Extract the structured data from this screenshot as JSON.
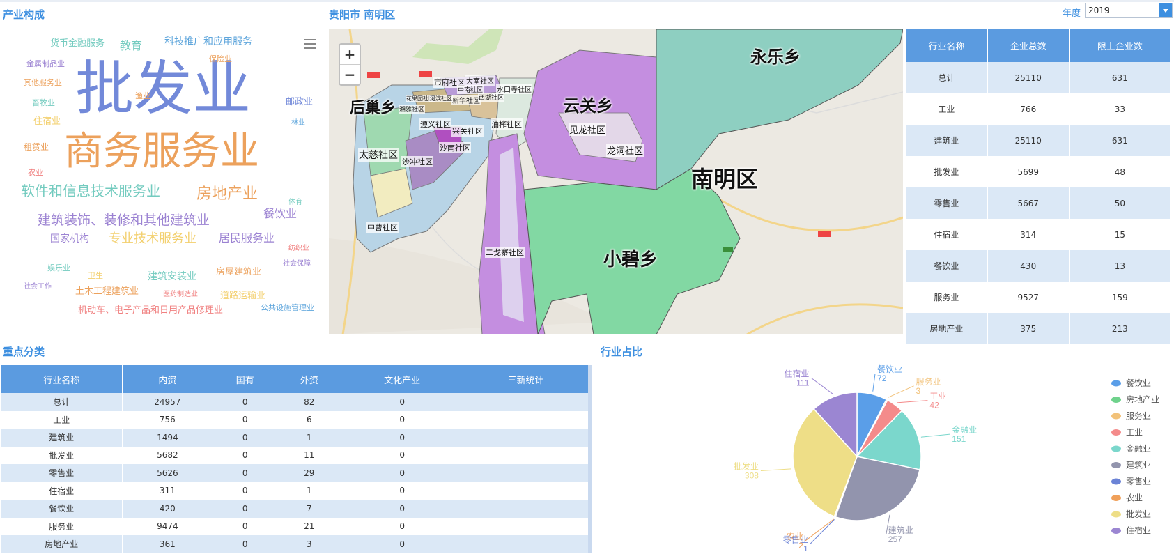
{
  "titles": {
    "industry": "产业构成",
    "city": "贵阳市 南明区",
    "key": "重点分类",
    "share": "行业占比"
  },
  "year": {
    "label": "年度",
    "value": "2019"
  },
  "zoom": {
    "plus": "+",
    "minus": "−"
  },
  "word_cloud": [
    {
      "text": "批发业",
      "color": "#7289d9"
    },
    {
      "text": "商务服务业",
      "color": "#eca15c"
    },
    {
      "text": "软件和信息技术服务业",
      "color": "#73cbbf"
    },
    {
      "text": "房地产业",
      "color": "#eca15c"
    },
    {
      "text": "建筑装饰、装修和其他建筑业",
      "color": "#9b82d2"
    },
    {
      "text": "餐饮业",
      "color": "#9b82d2"
    },
    {
      "text": "专业技术服务业",
      "color": "#f3d06f"
    },
    {
      "text": "居民服务业",
      "color": "#9b82d2"
    },
    {
      "text": "国家机构",
      "color": "#9b82d2"
    },
    {
      "text": "科技推广和应用服务",
      "color": "#5fa6dc"
    },
    {
      "text": "教育",
      "color": "#73cbbf"
    },
    {
      "text": "货币金融服务",
      "color": "#73cbbf"
    },
    {
      "text": "保险业",
      "color": "#eca15c"
    },
    {
      "text": "金属制品业",
      "color": "#9b82d2"
    },
    {
      "text": "其他服务业",
      "color": "#eca15c"
    },
    {
      "text": "渔业",
      "color": "#eca15c"
    },
    {
      "text": "邮政业",
      "color": "#7289d9"
    },
    {
      "text": "畜牧业",
      "color": "#73cbbf"
    },
    {
      "text": "住宿业",
      "color": "#f3d06f"
    },
    {
      "text": "林业",
      "color": "#5fa6dc"
    },
    {
      "text": "租赁业",
      "color": "#eca15c"
    },
    {
      "text": "农业",
      "color": "#f08080"
    },
    {
      "text": "体育",
      "color": "#73cbbf"
    },
    {
      "text": "纺织业",
      "color": "#f08080"
    },
    {
      "text": "社会保障",
      "color": "#9b82d2"
    },
    {
      "text": "娱乐业",
      "color": "#73cbbf"
    },
    {
      "text": "卫生",
      "color": "#f3d06f"
    },
    {
      "text": "建筑安装业",
      "color": "#73cbbf"
    },
    {
      "text": "房屋建筑业",
      "color": "#eca15c"
    },
    {
      "text": "社会工作",
      "color": "#9b82d2"
    },
    {
      "text": "土木工程建筑业",
      "color": "#eca15c"
    },
    {
      "text": "医药制造业",
      "color": "#f08080"
    },
    {
      "text": "道路运输业",
      "color": "#f3d06f"
    },
    {
      "text": "机动车、电子产品和日用产品修理业",
      "color": "#f08080"
    },
    {
      "text": "公共设施管理业",
      "color": "#5fa6dc"
    }
  ],
  "map_labels": [
    "永乐乡",
    "后巢乡",
    "云关乡",
    "南明区",
    "小碧乡",
    "太慈社区",
    "沙冲社区",
    "沙南社区",
    "兴关社区",
    "油榨社区",
    "见龙社区",
    "龙洞社区",
    "遵义社区",
    "中曹社区",
    "二戈寨社区",
    "市府社区",
    "大南社区",
    "中南社区",
    "水口寺社区",
    "新华社区",
    "西湖社区",
    "湘雅社区",
    "花果园社区",
    "河滨社区"
  ],
  "table1": {
    "headers": [
      "行业名称",
      "企业总数",
      "限上企业数"
    ],
    "rows": [
      [
        "总计",
        "25110",
        "631"
      ],
      [
        "工业",
        "766",
        "33"
      ],
      [
        "建筑业",
        "25110",
        "631"
      ],
      [
        "批发业",
        "5699",
        "48"
      ],
      [
        "零售业",
        "5667",
        "50"
      ],
      [
        "住宿业",
        "314",
        "15"
      ],
      [
        "餐饮业",
        "430",
        "13"
      ],
      [
        "服务业",
        "9527",
        "159"
      ],
      [
        "房地产业",
        "375",
        "213"
      ]
    ]
  },
  "table2": {
    "headers": [
      "行业名称",
      "内资",
      "国有",
      "外资",
      "文化产业",
      "三新统计"
    ],
    "rows": [
      [
        "总计",
        "24957",
        "0",
        "82",
        "0",
        ""
      ],
      [
        "工业",
        "756",
        "0",
        "6",
        "0",
        ""
      ],
      [
        "建筑业",
        "1494",
        "0",
        "1",
        "0",
        ""
      ],
      [
        "批发业",
        "5682",
        "0",
        "11",
        "0",
        ""
      ],
      [
        "零售业",
        "5626",
        "0",
        "29",
        "0",
        ""
      ],
      [
        "住宿业",
        "311",
        "0",
        "1",
        "0",
        ""
      ],
      [
        "餐饮业",
        "420",
        "0",
        "7",
        "0",
        ""
      ],
      [
        "服务业",
        "9474",
        "0",
        "21",
        "0",
        ""
      ],
      [
        "房地产业",
        "361",
        "0",
        "3",
        "0",
        ""
      ]
    ]
  },
  "chart_data": {
    "type": "pie",
    "title": "行业占比",
    "legend": [
      "餐饮业",
      "房地产业",
      "服务业",
      "工业",
      "金融业",
      "建筑业",
      "零售业",
      "农业",
      "批发业",
      "住宿业"
    ],
    "series": [
      {
        "name": "餐饮业",
        "value": 72,
        "color": "#5a9ee8"
      },
      {
        "name": "房地产业",
        "value": 0,
        "color": "#6fd28c"
      },
      {
        "name": "服务业",
        "value": 3,
        "color": "#f2c27a"
      },
      {
        "name": "工业",
        "value": 42,
        "color": "#f48b8b"
      },
      {
        "name": "金融业",
        "value": 151,
        "color": "#7bd7cc"
      },
      {
        "name": "建筑业",
        "value": 257,
        "color": "#9294ad"
      },
      {
        "name": "零售业",
        "value": 1,
        "color": "#6b83d6"
      },
      {
        "name": "农业",
        "value": 2,
        "color": "#f0a05a"
      },
      {
        "name": "批发业",
        "value": 308,
        "color": "#eede87"
      },
      {
        "name": "住宿业",
        "value": 111,
        "color": "#9b86d2"
      }
    ]
  }
}
